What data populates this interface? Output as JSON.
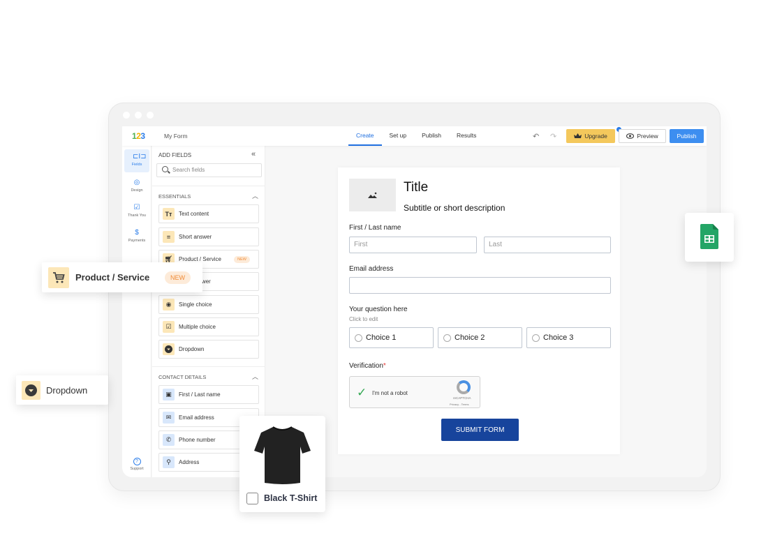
{
  "window": {
    "dots": 3
  },
  "topbar": {
    "logo": {
      "d1": "1",
      "d2": "2",
      "d3": "3"
    },
    "form_name": "My Form",
    "tabs": [
      {
        "label": "Create",
        "active": true
      },
      {
        "label": "Set up",
        "active": false
      },
      {
        "label": "Publish",
        "active": false
      },
      {
        "label": "Results",
        "active": false
      }
    ],
    "undo_icon": "undo-icon",
    "redo_icon": "redo-icon",
    "upgrade_label": "Upgrade",
    "preview_label": "Preview",
    "publish_label": "Publish",
    "colors": {
      "accent": "#1f6fe0",
      "upgrade": "#f4c85c",
      "publish": "#3d8ef0"
    }
  },
  "rail": {
    "items": [
      {
        "label": "Fields",
        "icon": "fields-icon",
        "active": true
      },
      {
        "label": "Design",
        "icon": "palette-icon",
        "active": false
      },
      {
        "label": "Thank You",
        "icon": "thank-you-icon",
        "active": false
      },
      {
        "label": "Payments",
        "icon": "dollar-icon",
        "active": false
      }
    ],
    "support": {
      "label": "Support",
      "icon": "help-icon",
      "glyph": "?"
    }
  },
  "panel": {
    "title": "ADD FIELDS",
    "collapse_glyph": "«",
    "search_placeholder": "Search fields",
    "sections": [
      {
        "title": "ESSENTIALS",
        "caret": "^",
        "items": [
          {
            "label": "Text content",
            "icon": "text-icon",
            "glyph": "Tт"
          },
          {
            "label": "Short answer",
            "icon": "short-answer-icon",
            "glyph": "="
          },
          {
            "label": "Product / Service",
            "icon": "cart-icon",
            "badge": "NEW"
          },
          {
            "label": "Long answer",
            "icon": "long-answer-icon",
            "glyph": "≡"
          },
          {
            "label": "Single choice",
            "icon": "radio-icon"
          },
          {
            "label": "Multiple choice",
            "icon": "checkbox-icon"
          },
          {
            "label": "Dropdown",
            "icon": "dropdown-icon"
          }
        ]
      },
      {
        "title": "CONTACT DETAILS",
        "caret": "^",
        "items": [
          {
            "label": "First / Last name",
            "icon": "contact-card-icon"
          },
          {
            "label": "Email address",
            "icon": "envelope-icon"
          },
          {
            "label": "Phone number",
            "icon": "phone-icon"
          },
          {
            "label": "Address",
            "icon": "location-pin-icon"
          }
        ]
      }
    ]
  },
  "form": {
    "title": "Title",
    "subtitle": "Subtitle or short description",
    "name_label": "First / Last name",
    "first_placeholder": "First",
    "last_placeholder": "Last",
    "email_label": "Email address",
    "email_value": "",
    "question_label": "Your question here",
    "question_hint": "Click to edit",
    "choices": [
      "Choice 1",
      "Choice 2",
      "Choice 3"
    ],
    "verification_label": "Verification",
    "required_mark": "*",
    "captcha": {
      "text": "I'm not a robot",
      "brand": "reCAPTCHA",
      "links": "Privacy - Terms",
      "checked": true
    },
    "submit_label": "SUBMIT FORM",
    "submit_color": "#17449c"
  },
  "floating": {
    "product_card": {
      "label": "Product / Service",
      "badge": "NEW"
    },
    "dropdown_card": {
      "label": "Dropdown"
    },
    "shirt_card": {
      "label": "Black T-Shirt",
      "checked": false
    },
    "sheets_card": {
      "icon": "google-sheets-icon"
    }
  }
}
